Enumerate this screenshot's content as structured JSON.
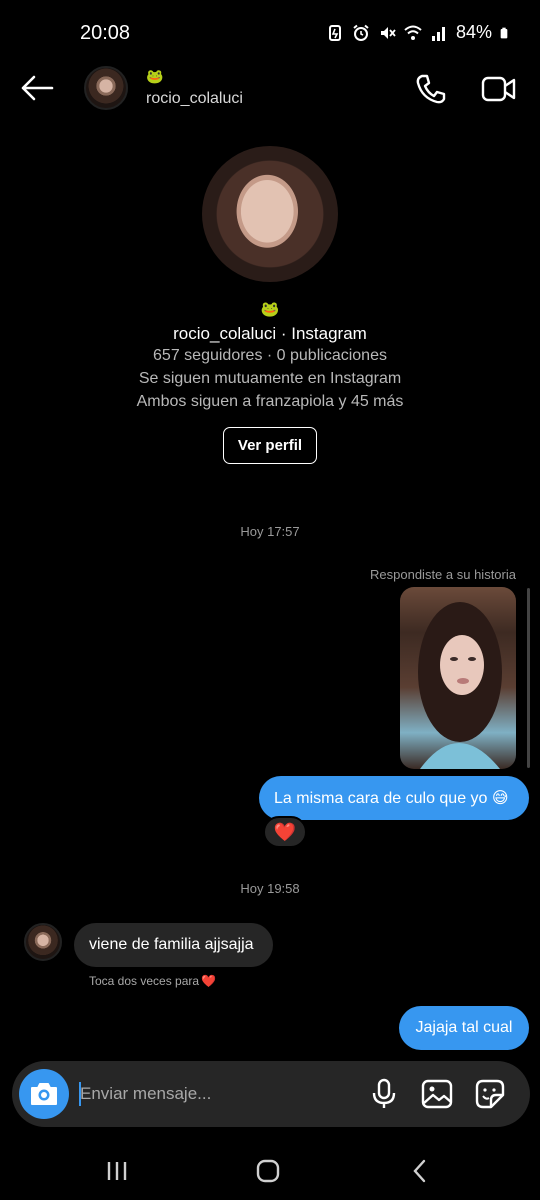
{
  "status_bar": {
    "time": "20:08",
    "battery": "84%",
    "icons": [
      "battery-saver-icon",
      "alarm-icon",
      "mute-icon",
      "wifi-icon",
      "signal-icon",
      "battery-icon"
    ]
  },
  "header": {
    "emoji": "🐸",
    "username": "rocio_colaluci",
    "icons": [
      "back-arrow-icon",
      "phone-call-icon",
      "video-call-icon"
    ]
  },
  "profile": {
    "emoji": "🐸",
    "title": "rocio_colaluci · Instagram",
    "stats": "657 seguidores · 0 publicaciones",
    "mutual": "Se siguen mutuamente en Instagram",
    "followed_by": "Ambos siguen a franzapiola y 45 más",
    "view_profile_label": "Ver perfil"
  },
  "conversation": {
    "timestamp_1": "Hoy 17:57",
    "story_reply_label": "Respondiste a su historia",
    "message_1": "La misma cara de culo que yo 😅",
    "reaction": "❤️",
    "timestamp_2": "Hoy 19:58",
    "message_2": "viene de familia ajjsajja",
    "double_tap_hint": "Toca dos veces para",
    "double_tap_emoji": "❤️",
    "message_3": "Jajaja tal cual"
  },
  "composer": {
    "placeholder": "Enviar mensaje...",
    "icons": [
      "camera-icon",
      "microphone-icon",
      "gallery-icon",
      "sticker-icon"
    ]
  },
  "colors": {
    "background": "#000000",
    "outgoing_bubble": "#3797f0",
    "incoming_bubble": "#262626",
    "secondary_text": "#a8a8a8"
  },
  "nav_bar": {
    "icons": [
      "recent-apps-icon",
      "home-icon",
      "back-icon"
    ]
  }
}
